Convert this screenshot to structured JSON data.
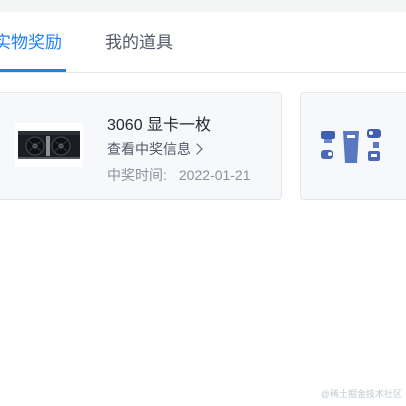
{
  "tabs": [
    {
      "label": "实物奖励",
      "active": true
    },
    {
      "label": "我的道具",
      "active": false
    }
  ],
  "prize": {
    "name": "3060 显卡一枚",
    "detail_link": "查看中奖信息",
    "date_label": "中奖时间:",
    "date_value": "2022-01-21",
    "thumbnail_icon": "graphics-card-icon"
  },
  "prize2": {
    "thumbnail_icon": "merch-bundle-icon"
  },
  "watermark": "@稀土掘金技术社区",
  "colors": {
    "accent": "#1e80ff",
    "card_bg": "#f7f8fa",
    "text_primary": "#252933",
    "text_muted": "#8a919f"
  }
}
